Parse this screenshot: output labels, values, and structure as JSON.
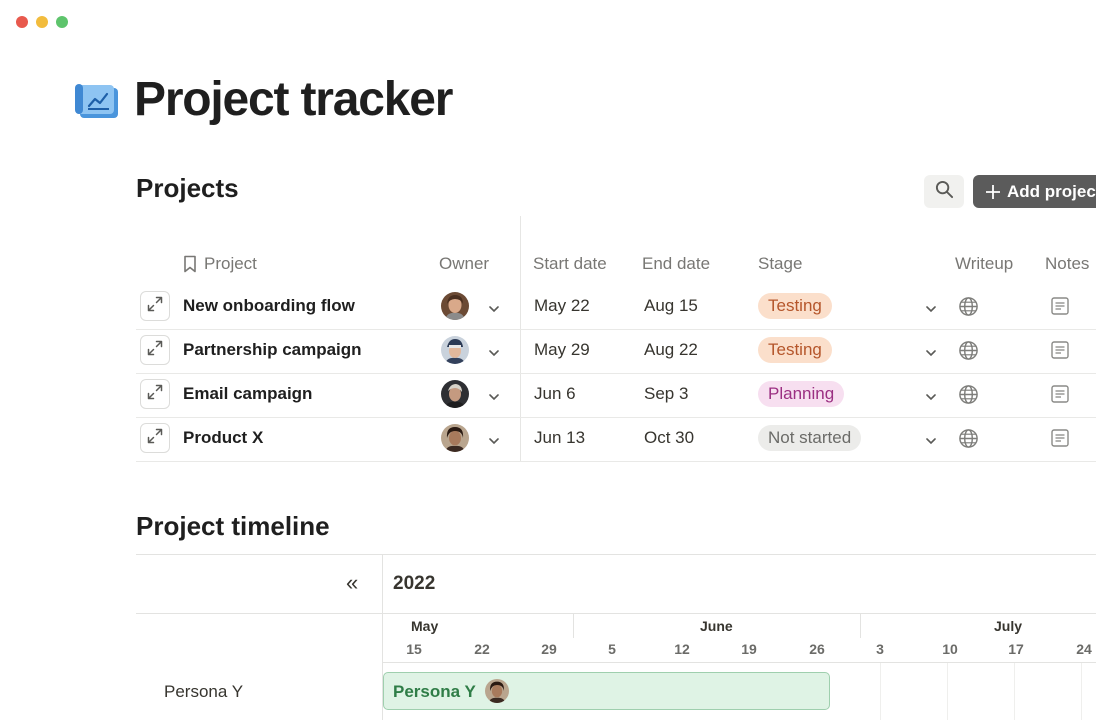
{
  "window": {
    "controls": [
      "close",
      "minimize",
      "maximize"
    ]
  },
  "page": {
    "title": "Project tracker",
    "icon": "chart-scroll-icon"
  },
  "projects": {
    "title": "Projects",
    "add_label": "Add project",
    "columns": {
      "project": "Project",
      "owner": "Owner",
      "start": "Start date",
      "end": "End date",
      "stage": "Stage",
      "writeup": "Writeup",
      "notes": "Notes"
    },
    "rows": [
      {
        "name": "New onboarding flow",
        "start": "May 22",
        "end": "Aug 15",
        "stage": "Testing"
      },
      {
        "name": "Partnership campaign",
        "start": "May 29",
        "end": "Aug 22",
        "stage": "Testing"
      },
      {
        "name": "Email campaign",
        "start": "Jun 6",
        "end": "Sep 3",
        "stage": "Planning"
      },
      {
        "name": "Product X",
        "start": "Jun 13",
        "end": "Oct 30",
        "stage": "Not started"
      }
    ],
    "stage_colors": {
      "Testing": {
        "bg": "#fbdfcb",
        "fg": "#b5562b"
      },
      "Planning": {
        "bg": "#f7dff0",
        "fg": "#9b2f82"
      },
      "Not started": {
        "bg": "#ececea",
        "fg": "#6b6b68"
      }
    }
  },
  "timeline": {
    "title": "Project timeline",
    "collapse_label": "«",
    "year": "2022",
    "months": [
      "May",
      "June",
      "July"
    ],
    "days": [
      "15",
      "22",
      "29",
      "5",
      "12",
      "19",
      "26",
      "3",
      "10",
      "17",
      "24"
    ],
    "rows": [
      {
        "label": "Persona Y",
        "bar_label": "Persona Y"
      }
    ]
  }
}
